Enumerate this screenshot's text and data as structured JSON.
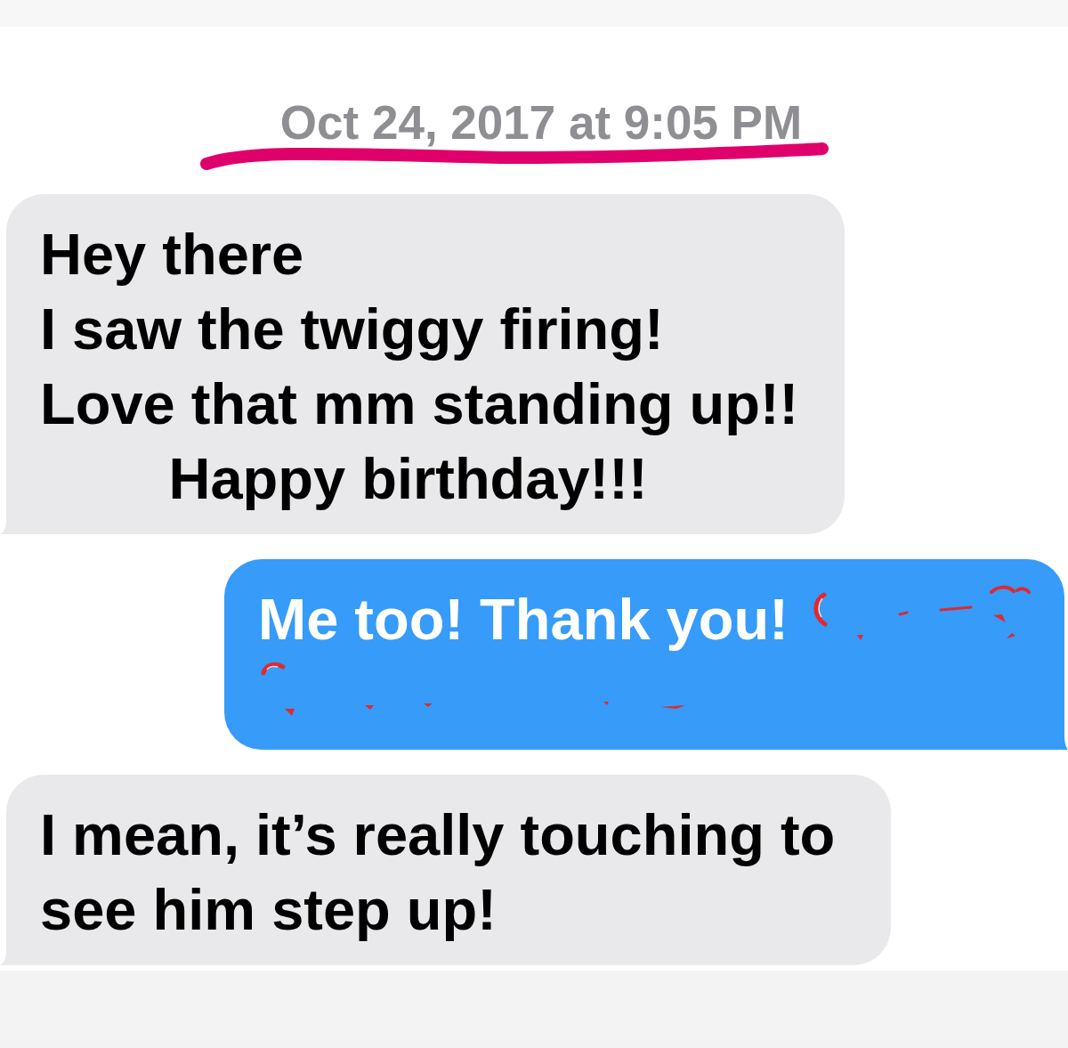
{
  "conversation": {
    "timestamp": {
      "text": "Oct 24, 2017 at 9:05 PM",
      "underlined": true
    },
    "messages": [
      {
        "kind": "received",
        "text": "Hey there\nI saw the twiggy firing!\nLove that mm standing up!!\n        Happy birthday!!!"
      },
      {
        "kind": "sent",
        "text": "Me too! Thank you!",
        "emoji_scribbled_out": true
      },
      {
        "kind": "received",
        "text": "I mean, it’s really touching to see him step up!"
      }
    ]
  }
}
